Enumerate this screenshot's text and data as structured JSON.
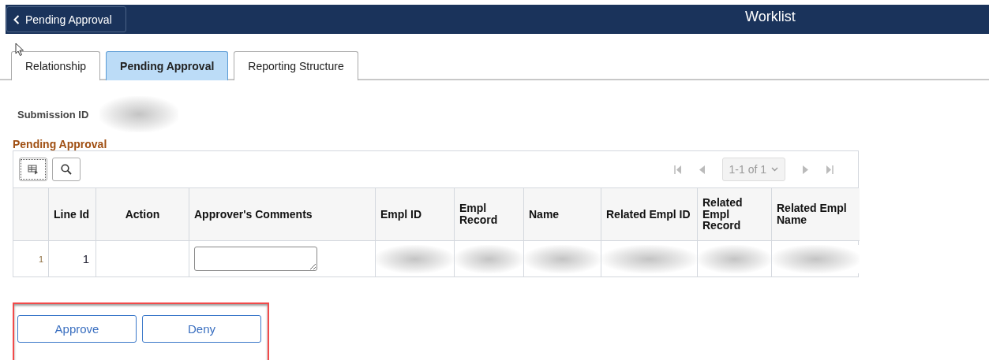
{
  "header": {
    "back_button": "Pending Approval",
    "title": "Worklist"
  },
  "tabs": [
    {
      "label": "Relationship",
      "selected": false
    },
    {
      "label": "Pending Approval",
      "selected": true
    },
    {
      "label": "Reporting Structure",
      "selected": false
    }
  ],
  "submission": {
    "label": "Submission ID"
  },
  "section_title": "Pending Approval",
  "grid": {
    "pager": {
      "range": "1-1 of 1"
    },
    "columns": [
      "",
      "Line Id",
      "Action",
      "Approver's Comments",
      "Empl ID",
      "Empl Record",
      "Name",
      "Related Empl ID",
      "Related Empl Record",
      "Related Empl Name"
    ],
    "rows": [
      {
        "cells": [
          {
            "kind": "rownum",
            "text": "1"
          },
          {
            "kind": "number",
            "text": "1"
          },
          {
            "kind": "empty"
          },
          {
            "kind": "textarea"
          },
          {
            "kind": "blurred"
          },
          {
            "kind": "blurred"
          },
          {
            "kind": "blurred"
          },
          {
            "kind": "blurred"
          },
          {
            "kind": "blurred"
          },
          {
            "kind": "blurred"
          }
        ]
      }
    ]
  },
  "buttons": [
    "Approve",
    "Deny"
  ]
}
